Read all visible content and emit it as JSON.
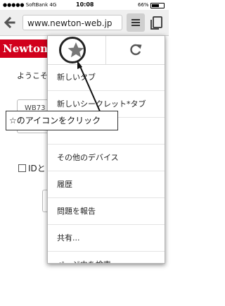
{
  "status_bar": {
    "carrier": "●●●●● SoftBank  4G",
    "time": "10:08",
    "battery": "66%"
  },
  "toolbar": {
    "url": "www.newton-web.jp"
  },
  "page": {
    "logo": "Newton",
    "welcome": "ようこそ",
    "user_id_partial": "WB73",
    "password_dots": "●●●●●",
    "remember_label": "IDと"
  },
  "menu": {
    "items": [
      "新しいタブ",
      "新しいシークレット*タブ",
      "",
      "その他のデバイス",
      "履歴",
      "問題を報告",
      "共有...",
      "ページ内を検索..."
    ]
  },
  "annotation": {
    "callout": "☆のアイコンをクリック"
  },
  "icons": {
    "back": "back-arrow-icon",
    "menu": "menu-icon",
    "tabs": "tabs-icon",
    "star": "star-icon",
    "reload": "reload-icon"
  }
}
